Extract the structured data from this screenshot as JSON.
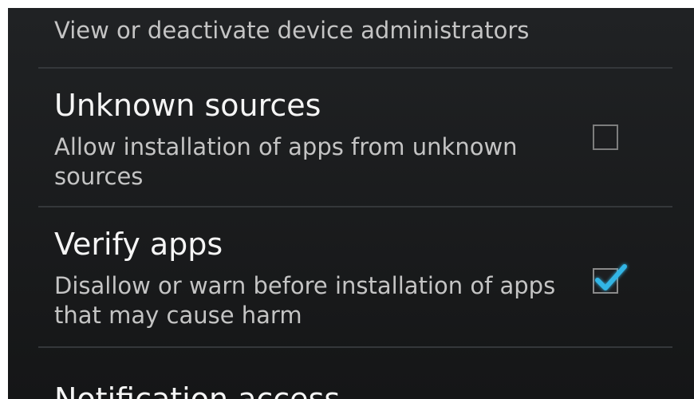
{
  "settings": {
    "items": [
      {
        "summary": "View or deactivate device administrators"
      },
      {
        "title": "Unknown sources",
        "summary": "Allow installation of apps from unknown sources",
        "checked": false
      },
      {
        "title": "Verify apps",
        "summary": "Disallow or warn before installation of apps that may cause harm",
        "checked": true
      },
      {
        "title": "Notification access"
      }
    ]
  },
  "colors": {
    "accent": "#33b5e5",
    "background": "#1b1c1e",
    "divider": "#34373a"
  },
  "icons": {
    "check": "check-icon"
  }
}
